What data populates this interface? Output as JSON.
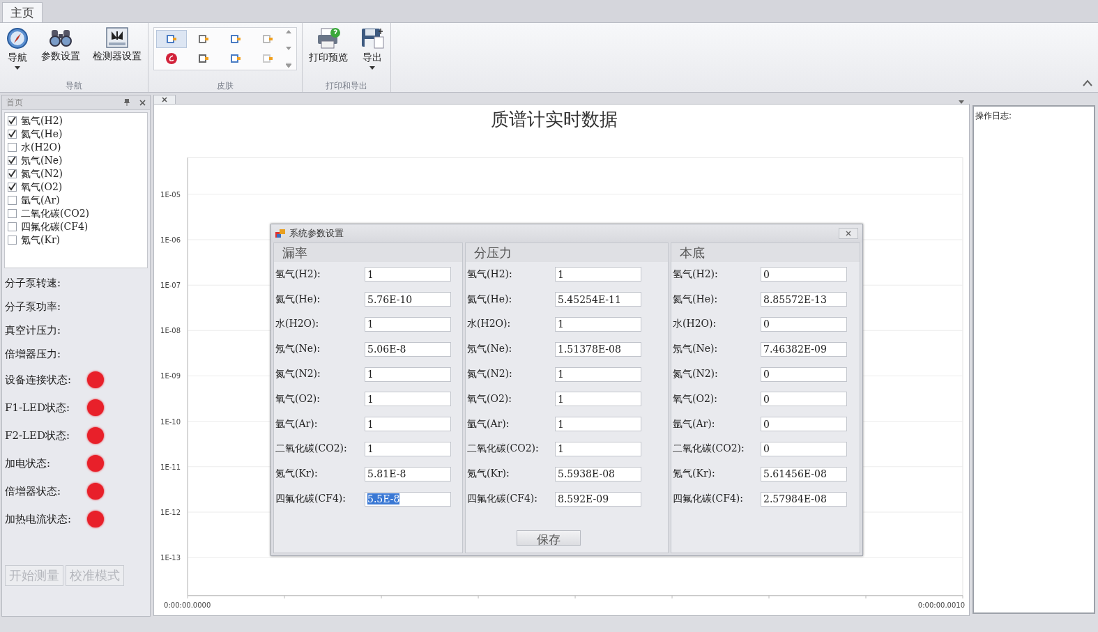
{
  "ribbon": {
    "tabs": [
      {
        "label": "主页",
        "selected": true
      }
    ],
    "groups": [
      {
        "kind": "buttons",
        "title": "导航",
        "buttons": [
          {
            "label": "导航",
            "dropdown": true
          },
          {
            "label": "参数设置",
            "dropdown": false
          },
          {
            "label": "检测器设置",
            "dropdown": false
          }
        ]
      },
      {
        "kind": "gallery",
        "title": "皮肤",
        "skins": [
          {
            "selected": true
          },
          {
            "selected": false
          },
          {
            "selected": false
          },
          {
            "selected": false
          },
          {
            "selected": false
          },
          {
            "selected": false
          },
          {
            "selected": false
          },
          {
            "selected": false
          }
        ]
      },
      {
        "kind": "buttons",
        "title": "打印和导出",
        "buttons": [
          {
            "label": "打印预览",
            "dropdown": false
          },
          {
            "label": "导出",
            "dropdown": true
          }
        ]
      }
    ]
  },
  "side_panel": {
    "title": "首页",
    "gases": [
      {
        "label": "氢气(H2)",
        "checked": true
      },
      {
        "label": "氦气(He)",
        "checked": true
      },
      {
        "label": "水(H2O)",
        "checked": false
      },
      {
        "label": "氖气(Ne)",
        "checked": true
      },
      {
        "label": "氮气(N2)",
        "checked": true
      },
      {
        "label": "氧气(O2)",
        "checked": true
      },
      {
        "label": "氩气(Ar)",
        "checked": false
      },
      {
        "label": "二氧化碳(CO2)",
        "checked": false
      },
      {
        "label": "四氟化碳(CF4)",
        "checked": false
      },
      {
        "label": "氪气(Kr)",
        "checked": false
      }
    ],
    "status": [
      {
        "kind": "reading",
        "label": "分子泵转速:"
      },
      {
        "kind": "reading",
        "label": "分子泵功率:"
      },
      {
        "kind": "reading",
        "label": "真空计压力:"
      },
      {
        "kind": "reading",
        "label": "倍增器压力:"
      },
      {
        "kind": "indicator",
        "label": "设备连接状态:",
        "color": "#e8202a"
      },
      {
        "kind": "indicator",
        "label": "F1-LED状态:",
        "color": "#e8202a"
      },
      {
        "kind": "indicator",
        "label": "F2-LED状态:",
        "color": "#e8202a"
      },
      {
        "kind": "indicator",
        "label": "加电状态:",
        "color": "#e8202a"
      },
      {
        "kind": "indicator",
        "label": "倍增器状态:",
        "color": "#e8202a"
      },
      {
        "kind": "indicator",
        "label": "加热电流状态:",
        "color": "#e8202a"
      }
    ],
    "buttons": [
      {
        "label": "开始测量",
        "disabled": true
      },
      {
        "label": "校准模式",
        "disabled": true
      }
    ]
  },
  "chart_panel": {
    "title": "质谱计实时数据",
    "y_axis_labels": [
      "1E-05",
      "1E-06",
      "1E-07",
      "1E-08",
      "1E-09",
      "1E-10",
      "1E-11",
      "1E-12",
      "1E-13"
    ],
    "x_axis_labels": [
      "0:00:00.0000",
      "0:00:00.0010"
    ]
  },
  "dialog": {
    "title": "系统参数设置",
    "save_button": "保存",
    "sections": [
      {
        "heading": "漏率",
        "fields": [
          {
            "label": "氢气(H2):",
            "value": "1",
            "selected": false
          },
          {
            "label": "氦气(He):",
            "value": "5.76E-10",
            "selected": false
          },
          {
            "label": "水(H2O):",
            "value": "1",
            "selected": false
          },
          {
            "label": "氖气(Ne):",
            "value": "5.06E-8",
            "selected": false
          },
          {
            "label": "氮气(N2):",
            "value": "1",
            "selected": false
          },
          {
            "label": "氧气(O2):",
            "value": "1",
            "selected": false
          },
          {
            "label": "氩气(Ar):",
            "value": "1",
            "selected": false
          },
          {
            "label": "二氧化碳(CO2):",
            "value": "1",
            "selected": false
          },
          {
            "label": "氪气(Kr):",
            "value": "5.81E-8",
            "selected": false
          },
          {
            "label": "四氟化碳(CF4):",
            "value": "5.5E-8",
            "selected": true
          }
        ]
      },
      {
        "heading": "分压力",
        "fields": [
          {
            "label": "氢气(H2):",
            "value": "1",
            "selected": false
          },
          {
            "label": "氦气(He):",
            "value": "5.45254E-11",
            "selected": false
          },
          {
            "label": "水(H2O):",
            "value": "1",
            "selected": false
          },
          {
            "label": "氖气(Ne):",
            "value": "1.51378E-08",
            "selected": false
          },
          {
            "label": "氮气(N2):",
            "value": "1",
            "selected": false
          },
          {
            "label": "氧气(O2):",
            "value": "1",
            "selected": false
          },
          {
            "label": "氩气(Ar):",
            "value": "1",
            "selected": false
          },
          {
            "label": "二氧化碳(CO2):",
            "value": "1",
            "selected": false
          },
          {
            "label": "氪气(Kr):",
            "value": "5.5938E-08",
            "selected": false
          },
          {
            "label": "四氟化碳(CF4):",
            "value": "8.592E-09",
            "selected": false
          }
        ]
      },
      {
        "heading": "本底",
        "fields": [
          {
            "label": "氢气(H2):",
            "value": "0",
            "selected": false
          },
          {
            "label": "氦气(He):",
            "value": "8.85572E-13",
            "selected": false
          },
          {
            "label": "水(H2O):",
            "value": "0",
            "selected": false
          },
          {
            "label": "氖气(Ne):",
            "value": "7.46382E-09",
            "selected": false
          },
          {
            "label": "氮气(N2):",
            "value": "0",
            "selected": false
          },
          {
            "label": "氧气(O2):",
            "value": "0",
            "selected": false
          },
          {
            "label": "氩气(Ar):",
            "value": "0",
            "selected": false
          },
          {
            "label": "二氧化碳(CO2):",
            "value": "0",
            "selected": false
          },
          {
            "label": "氪气(Kr):",
            "value": "5.61456E-08",
            "selected": false
          },
          {
            "label": "四氟化碳(CF4):",
            "value": "2.57984E-08",
            "selected": false
          }
        ]
      }
    ]
  },
  "log_panel": {
    "title": "操作日志:"
  }
}
